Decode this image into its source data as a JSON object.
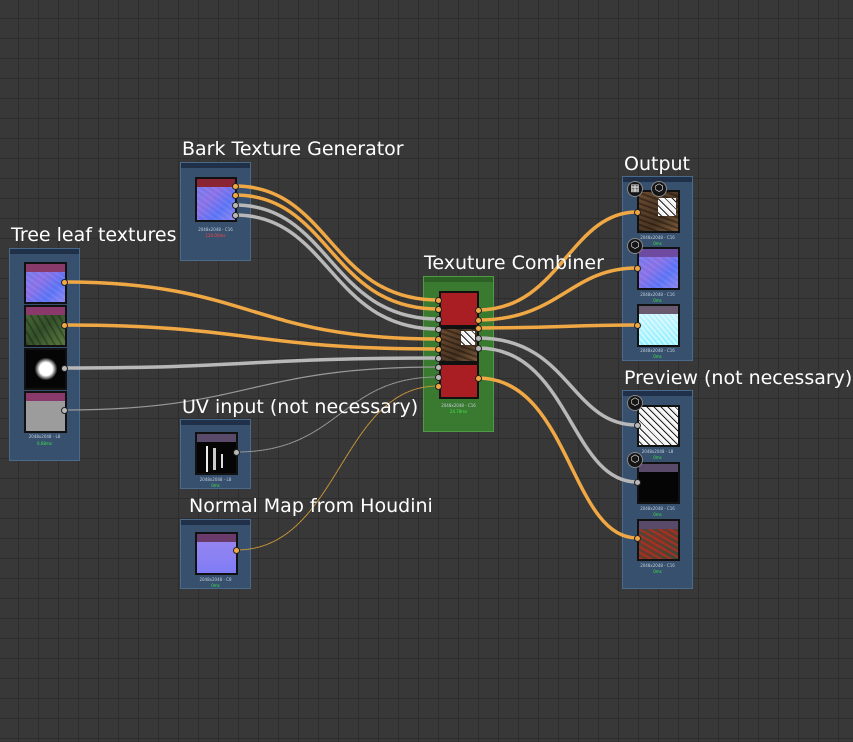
{
  "graph": {
    "frames": [
      {
        "id": "bark",
        "title": "Bark Texture Generator",
        "caption": "2048x2048 - C16",
        "timing": "120.00ms"
      },
      {
        "id": "leaf",
        "title": "Tree leaf textures",
        "caption": "2048x2048 - L8",
        "timing": "0.68ms"
      },
      {
        "id": "combiner",
        "title": "Texuture Combiner",
        "caption": "2048x2048 - C16",
        "timing": "24.78ms"
      },
      {
        "id": "output",
        "title": "Output",
        "captions": [
          "2048x2048 - C16",
          "2048x2048 - C16",
          "2048x2048 - C16"
        ],
        "timings": [
          "0ms",
          "0ms",
          "0ms"
        ]
      },
      {
        "id": "preview",
        "title": "Preview (not necessary)",
        "captions": [
          "2048x2048 - L8",
          "2048x2048 - C16",
          "2048x2048 - C16"
        ],
        "timings": [
          "0ms",
          "0ms",
          "0ms"
        ]
      },
      {
        "id": "uv",
        "title": "UV input (not necessary)",
        "caption": "2048x2048 - L8",
        "timing": "0ms"
      },
      {
        "id": "normal",
        "title": "Normal Map from Houdini",
        "caption": "2048x2048 - C8",
        "timing": "0ms"
      }
    ],
    "colors": {
      "background": "#383838",
      "node": "#36506e",
      "combiner": "#3a7a30",
      "wire_color": "#f0a845",
      "wire_grey": "#b8b8b8"
    },
    "icons": {
      "output_badges": [
        "checker-icon",
        "cube-icon",
        "cube-icon"
      ],
      "preview_badges": [
        "cube-icon",
        "cube-icon"
      ]
    }
  }
}
